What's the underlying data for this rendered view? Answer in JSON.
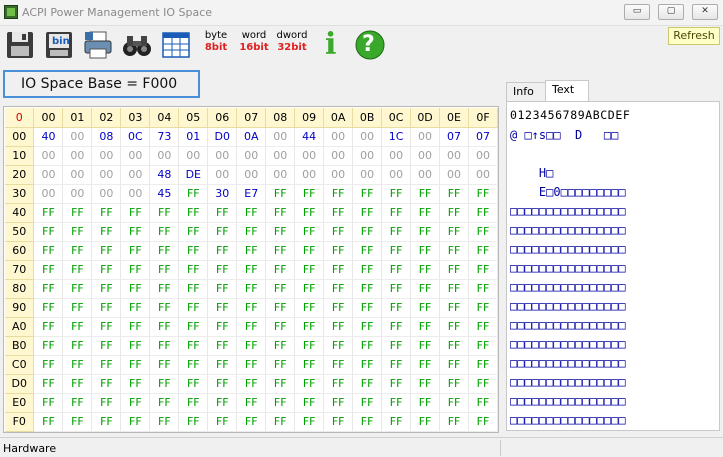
{
  "window": {
    "title": "ACPI Power Management IO Space"
  },
  "titlebar_buttons": {
    "minimize": "▭",
    "maximize": "▢",
    "close": "✕"
  },
  "toolbar": {
    "icons": [
      "save-icon",
      "save-binary-icon",
      "print-icon",
      "find-icon",
      "layout-icon"
    ],
    "save_bin_label": "bin",
    "byte": {
      "top": "byte",
      "bottom": "8bit"
    },
    "word": {
      "top": "word",
      "bottom": "16bit"
    },
    "dword": {
      "top": "dword",
      "bottom": "32bit"
    },
    "info_icon": "i",
    "help_icon": "?",
    "refresh": "Refresh"
  },
  "base_label": "IO Space Base = F000",
  "grid": {
    "corner": "0",
    "columns": [
      "00",
      "01",
      "02",
      "03",
      "04",
      "05",
      "06",
      "07",
      "08",
      "09",
      "0A",
      "0B",
      "0C",
      "0D",
      "0E",
      "0F"
    ],
    "rows": [
      {
        "addr": "00",
        "cells": [
          "40",
          "00",
          "08",
          "0C",
          "73",
          "01",
          "D0",
          "0A",
          "00",
          "44",
          "00",
          "00",
          "1C",
          "00",
          "07",
          "07"
        ]
      },
      {
        "addr": "10",
        "cells": [
          "00",
          "00",
          "00",
          "00",
          "00",
          "00",
          "00",
          "00",
          "00",
          "00",
          "00",
          "00",
          "00",
          "00",
          "00",
          "00"
        ]
      },
      {
        "addr": "20",
        "cells": [
          "00",
          "00",
          "00",
          "00",
          "48",
          "DE",
          "00",
          "00",
          "00",
          "00",
          "00",
          "00",
          "00",
          "00",
          "00",
          "00"
        ]
      },
      {
        "addr": "30",
        "cells": [
          "00",
          "00",
          "00",
          "00",
          "45",
          "FF",
          "30",
          "E7",
          "FF",
          "FF",
          "FF",
          "FF",
          "FF",
          "FF",
          "FF",
          "FF"
        ]
      },
      {
        "addr": "40",
        "cells": [
          "FF",
          "FF",
          "FF",
          "FF",
          "FF",
          "FF",
          "FF",
          "FF",
          "FF",
          "FF",
          "FF",
          "FF",
          "FF",
          "FF",
          "FF",
          "FF"
        ]
      },
      {
        "addr": "50",
        "cells": [
          "FF",
          "FF",
          "FF",
          "FF",
          "FF",
          "FF",
          "FF",
          "FF",
          "FF",
          "FF",
          "FF",
          "FF",
          "FF",
          "FF",
          "FF",
          "FF"
        ]
      },
      {
        "addr": "60",
        "cells": [
          "FF",
          "FF",
          "FF",
          "FF",
          "FF",
          "FF",
          "FF",
          "FF",
          "FF",
          "FF",
          "FF",
          "FF",
          "FF",
          "FF",
          "FF",
          "FF"
        ]
      },
      {
        "addr": "70",
        "cells": [
          "FF",
          "FF",
          "FF",
          "FF",
          "FF",
          "FF",
          "FF",
          "FF",
          "FF",
          "FF",
          "FF",
          "FF",
          "FF",
          "FF",
          "FF",
          "FF"
        ]
      },
      {
        "addr": "80",
        "cells": [
          "FF",
          "FF",
          "FF",
          "FF",
          "FF",
          "FF",
          "FF",
          "FF",
          "FF",
          "FF",
          "FF",
          "FF",
          "FF",
          "FF",
          "FF",
          "FF"
        ]
      },
      {
        "addr": "90",
        "cells": [
          "FF",
          "FF",
          "FF",
          "FF",
          "FF",
          "FF",
          "FF",
          "FF",
          "FF",
          "FF",
          "FF",
          "FF",
          "FF",
          "FF",
          "FF",
          "FF"
        ]
      },
      {
        "addr": "A0",
        "cells": [
          "FF",
          "FF",
          "FF",
          "FF",
          "FF",
          "FF",
          "FF",
          "FF",
          "FF",
          "FF",
          "FF",
          "FF",
          "FF",
          "FF",
          "FF",
          "FF"
        ]
      },
      {
        "addr": "B0",
        "cells": [
          "FF",
          "FF",
          "FF",
          "FF",
          "FF",
          "FF",
          "FF",
          "FF",
          "FF",
          "FF",
          "FF",
          "FF",
          "FF",
          "FF",
          "FF",
          "FF"
        ]
      },
      {
        "addr": "C0",
        "cells": [
          "FF",
          "FF",
          "FF",
          "FF",
          "FF",
          "FF",
          "FF",
          "FF",
          "FF",
          "FF",
          "FF",
          "FF",
          "FF",
          "FF",
          "FF",
          "FF"
        ]
      },
      {
        "addr": "D0",
        "cells": [
          "FF",
          "FF",
          "FF",
          "FF",
          "FF",
          "FF",
          "FF",
          "FF",
          "FF",
          "FF",
          "FF",
          "FF",
          "FF",
          "FF",
          "FF",
          "FF"
        ]
      },
      {
        "addr": "E0",
        "cells": [
          "FF",
          "FF",
          "FF",
          "FF",
          "FF",
          "FF",
          "FF",
          "FF",
          "FF",
          "FF",
          "FF",
          "FF",
          "FF",
          "FF",
          "FF",
          "FF"
        ]
      },
      {
        "addr": "F0",
        "cells": [
          "FF",
          "FF",
          "FF",
          "FF",
          "FF",
          "FF",
          "FF",
          "FF",
          "FF",
          "FF",
          "FF",
          "FF",
          "FF",
          "FF",
          "FF",
          "FF"
        ]
      }
    ]
  },
  "tabs": [
    {
      "label": "Info"
    },
    {
      "label": "Text"
    }
  ],
  "text_pane": {
    "header": "0123456789ABCDEF",
    "rows": [
      "@ □↑s□□  D   □□",
      "",
      "    H□",
      "    E□0□□□□□□□□□",
      "□□□□□□□□□□□□□□□□",
      "□□□□□□□□□□□□□□□□",
      "□□□□□□□□□□□□□□□□",
      "□□□□□□□□□□□□□□□□",
      "□□□□□□□□□□□□□□□□",
      "□□□□□□□□□□□□□□□□",
      "□□□□□□□□□□□□□□□□",
      "□□□□□□□□□□□□□□□□",
      "□□□□□□□□□□□□□□□□",
      "□□□□□□□□□□□□□□□□",
      "□□□□□□□□□□□□□□□□",
      "□□□□□□□□□□□□□□□□"
    ]
  },
  "status": {
    "text": "Hardware"
  },
  "colors": {
    "accent_border": "#4a90d9",
    "zero": "#a0a0a0",
    "ff": "#00a000",
    "value": "#0000c8",
    "corner": "#e00000",
    "header_bg": "#fff7d0"
  }
}
